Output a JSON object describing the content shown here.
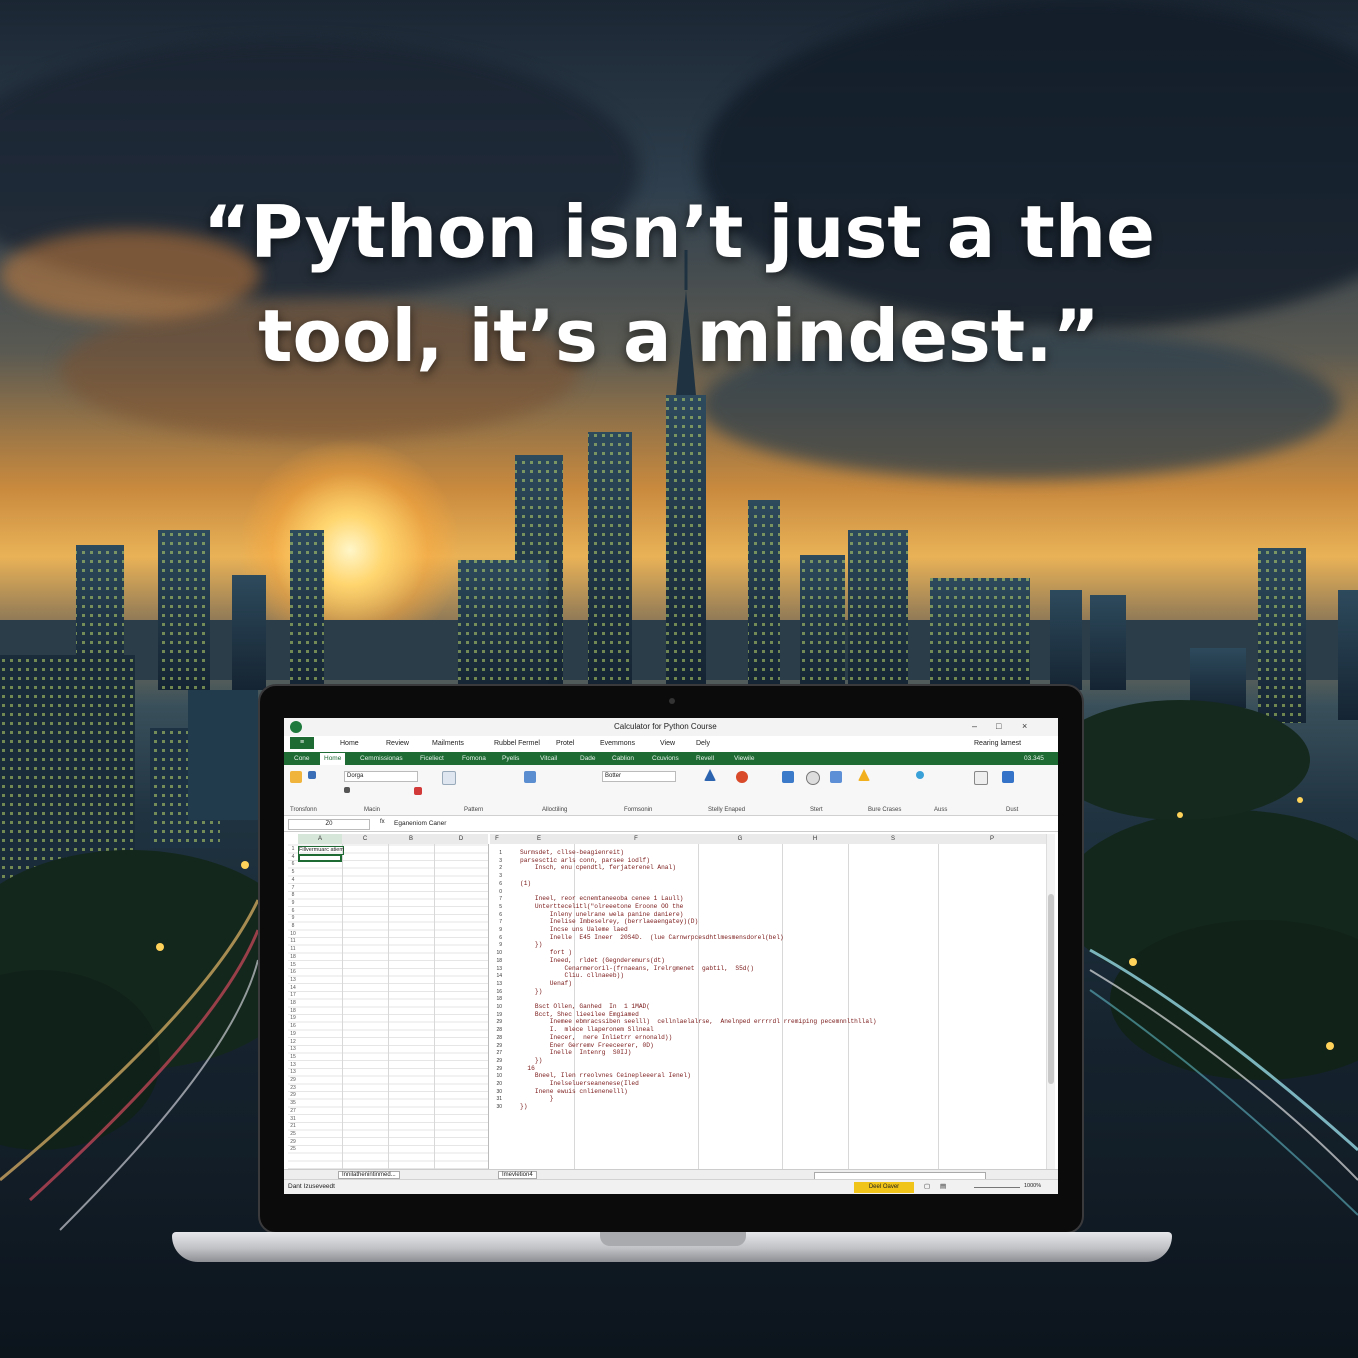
{
  "quote": {
    "line1": "“Python isn’t just a the",
    "line2": "tool, it’s a mindest.”"
  },
  "colors": {
    "ribbon_green": "#1e6b34",
    "status_highlight": "#f0c419",
    "code_text": "#7a1818"
  },
  "excel": {
    "window_title": "Calculator for Python Course",
    "menu": [
      "Home",
      "Review",
      "Mailments",
      "Rubbel Fermel",
      "Protel",
      "Evemmons",
      "View",
      "Dely"
    ],
    "user": "Rearing lamest",
    "ribbon_tabs": [
      "Cone",
      "Home",
      "Cemmissionas",
      "Ficeliect",
      "Fomona",
      "Pyelis",
      "Vitcail",
      "Dade",
      "Cablion",
      "Ccuvions",
      "Revell",
      "Viewile"
    ],
    "ribbon_right_code": "03.345",
    "ribbon_groups": [
      "Tronsfonn",
      "Macin",
      "Pattern",
      "Alloctiling",
      "Formsonin",
      "Stelly Enaped",
      "Stert",
      "Bure Crases",
      "Auss",
      "Dust"
    ],
    "font_box": "Dorga",
    "font_box2": "Botter",
    "name_box": "Z0",
    "formula": "Eganeniom Caner",
    "col_headers": [
      "A",
      "C",
      "B",
      "D",
      "F",
      "E",
      "F",
      "G",
      "H",
      "S",
      "P"
    ],
    "cell_a1": "Fillvermuarc atiem",
    "code_lines": [
      "Surmsdet, cllse-beagienreit)",
      "parsesctic arls conn, parsee iodlf)",
      "    Insch, enu cpendtl, ferjaterenel Anal)",
      "",
      "(1)",
      "",
      "    Ineel, reor ecnemtaneeoba cenee 1 Laull)",
      "    Unterttecelitl(\"olreeetone Eroone OO the",
      "        Inleny unelrane wela panine daniere)",
      "        Inelise Imbeselrey, (berrlaeaengatey)(D)",
      "        Incse uns Ualeme laed",
      "        Inelle  E45 Ineer  20S4D.  (lue Carnwrpcesdhtlmesmensdorel(bel)",
      "    })",
      "        fort )",
      "        Ineed,  rldet (Gegnderemurs(dt)",
      "            Cenarmeroril-(frnaeans, Irelrgmenet  gabtil,  S5d()",
      "            Cliu. cllnaeeb))",
      "        Uenaf)",
      "    })",
      "",
      "    Bsct Ollen, Ganhed  In  1 1MAD(",
      "    Bcct, Shec lieeilee Emgiamed",
      "        Inemee ebmracssiben seelll)  cellnlaelalrse,  Anelnped errrrdl rremiping pecemnnlthllal)",
      "        I.  mlece llaperonem Sllneal",
      "        Inecer,  nere Inlietrr ernonald))",
      "        Ener Gerremv Freeceerer, 0D)",
      "        Inelle  Intenrg  S0IJ)",
      "    })",
      "  16",
      "    Bneel, Ilen rreolvnes Ceinepleeeral Ienel)",
      "        Inelseluerseanenese(Iled",
      "    Inene ewuis cnlienenelll)",
      "        }",
      "})"
    ],
    "line_numbers": [
      "1",
      "3",
      "2",
      "3",
      "6",
      "0",
      "7",
      "5",
      "6",
      "7",
      "9",
      "6",
      "9",
      "10",
      "18",
      "13",
      "14",
      "13",
      "16",
      "18",
      "10",
      "19",
      "29",
      "28",
      "28",
      "29",
      "27",
      "29",
      "29",
      "10",
      "20",
      "30",
      "31",
      "30"
    ],
    "row_numbers": [
      "1",
      "4",
      "6",
      "5",
      "4",
      "7",
      "8",
      "9",
      "6",
      "9",
      "8",
      "10",
      "11",
      "11",
      "18",
      "15",
      "16",
      "13",
      "14",
      "17",
      "18",
      "18",
      "19",
      "16",
      "19",
      "12",
      "13",
      "15",
      "13",
      "13",
      "29",
      "23",
      "29",
      "35",
      "27",
      "31",
      "21",
      "25",
      "29",
      "25"
    ],
    "sheet_tab1": "Innilathenintinmed...",
    "sheet_tab2": "Imevletion4",
    "status_left": "Dant Izuseveedt",
    "status_button": "Deel Oaver",
    "status_right": "1000%"
  }
}
